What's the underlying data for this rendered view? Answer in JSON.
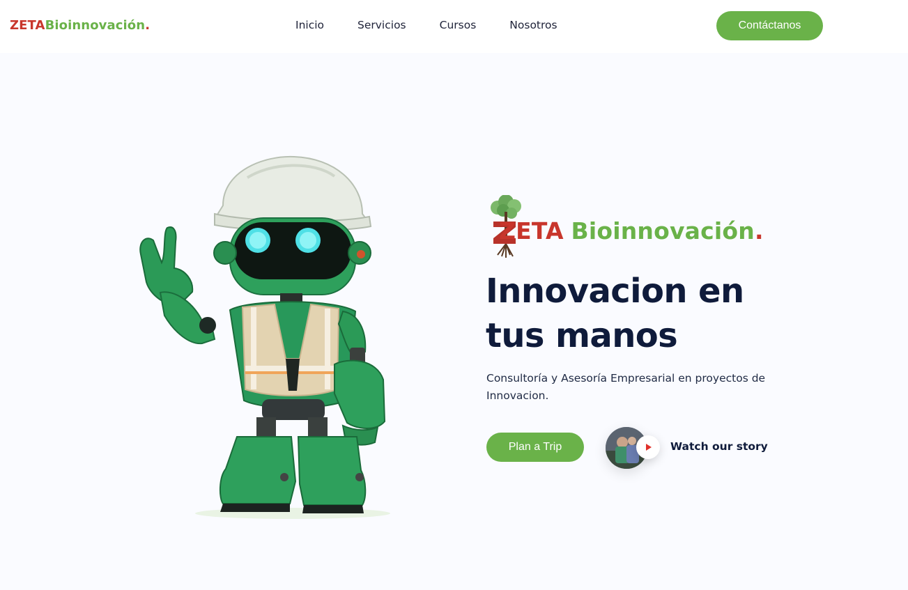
{
  "header": {
    "brand": {
      "part1": "ZETA",
      "part2": "Bioinnovación",
      "part3": "."
    },
    "nav": [
      {
        "label": "Inicio"
      },
      {
        "label": "Servicios"
      },
      {
        "label": "Cursos"
      },
      {
        "label": "Nosotros"
      }
    ],
    "cta_label": "Contáctanos"
  },
  "hero": {
    "logo": {
      "part1": "ZETA",
      "part2": "Bioinnovación",
      "part3": "."
    },
    "headline": "Innovacion en tus manos",
    "subtitle": "Consultoría y Asesoría Empresarial en proyectos de Innovacion.",
    "primary_button": "Plan a Trip",
    "story_label": "Watch our story"
  },
  "colors": {
    "accent_green": "#6ab249",
    "brand_red": "#c8362c",
    "heading_navy": "#0f1b3b",
    "background": "#fafbff"
  },
  "icons": [
    "tree-logo-icon",
    "play-icon",
    "robot-illustration"
  ]
}
